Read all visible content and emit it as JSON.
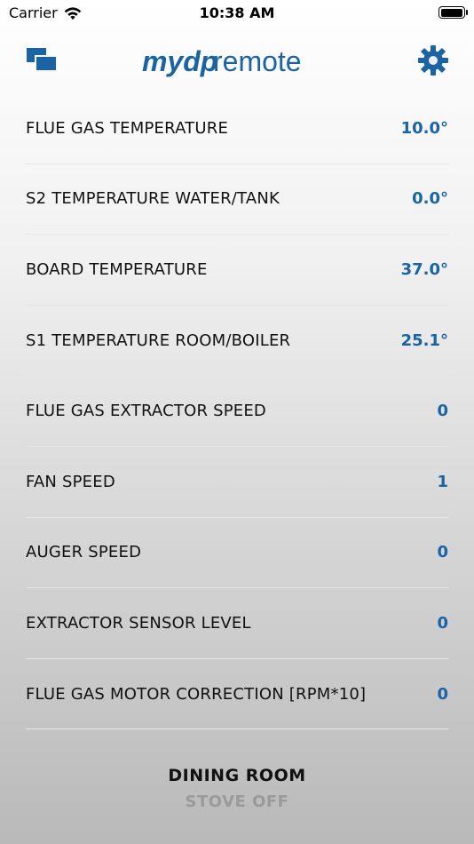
{
  "status_bar": {
    "carrier": "Carrier",
    "time": "10:38 AM",
    "icons": [
      "wifi-icon",
      "battery-icon"
    ]
  },
  "header": {
    "logo_text_1": "mydp",
    "logo_text_2": "remote",
    "left_icon": "windows-icon",
    "right_icon": "gear-icon",
    "accent_color": "#1a64a3"
  },
  "rows": [
    {
      "label": "FLUE GAS TEMPERATURE",
      "value": "10.0°"
    },
    {
      "label": "S2 TEMPERATURE WATER/TANK",
      "value": "0.0°"
    },
    {
      "label": "BOARD TEMPERATURE",
      "value": "37.0°"
    },
    {
      "label": "S1 TEMPERATURE ROOM/BOILER",
      "value": "25.1°"
    },
    {
      "label": "FLUE GAS EXTRACTOR SPEED",
      "value": "0"
    },
    {
      "label": "FAN SPEED",
      "value": "1"
    },
    {
      "label": "AUGER SPEED",
      "value": "0"
    },
    {
      "label": "EXTRACTOR SENSOR LEVEL",
      "value": "0"
    },
    {
      "label": "FLUE GAS MOTOR CORRECTION [RPM*10]",
      "value": "0"
    }
  ],
  "footer": {
    "room": "DINING ROOM",
    "status": "STOVE OFF"
  }
}
